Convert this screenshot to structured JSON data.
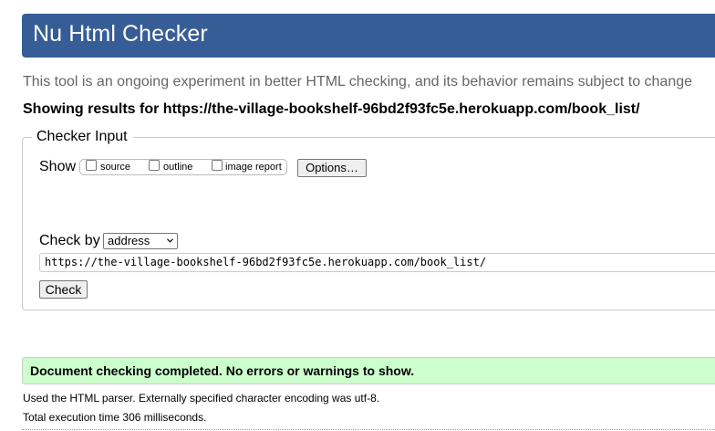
{
  "header": {
    "title": "Nu Html Checker"
  },
  "tagline": "This tool is an ongoing experiment in better HTML checking, and its behavior remains subject to change",
  "showing_results": "Showing results for https://the-village-bookshelf-96bd2f93fc5e.herokuapp.com/book_list/",
  "checker_input": {
    "legend": "Checker Input",
    "show_label": "Show",
    "options": [
      {
        "label": "source",
        "checked": false
      },
      {
        "label": "outline",
        "checked": false
      },
      {
        "label": "image report",
        "checked": false
      }
    ],
    "options_button": "Options…",
    "check_by_label": "Check by",
    "check_by_value": "address",
    "url_value": "https://the-village-bookshelf-96bd2f93fc5e.herokuapp.com/book_list/",
    "check_button": "Check"
  },
  "result": {
    "status": "Document checking completed. No errors or warnings to show.",
    "status_color": "#ccffcc",
    "parser_info": "Used the HTML parser. Externally specified character encoding was utf-8.",
    "execution_time": "Total execution time 306 milliseconds."
  },
  "colors": {
    "header_bg": "#365d95",
    "tagline": "#666666"
  }
}
